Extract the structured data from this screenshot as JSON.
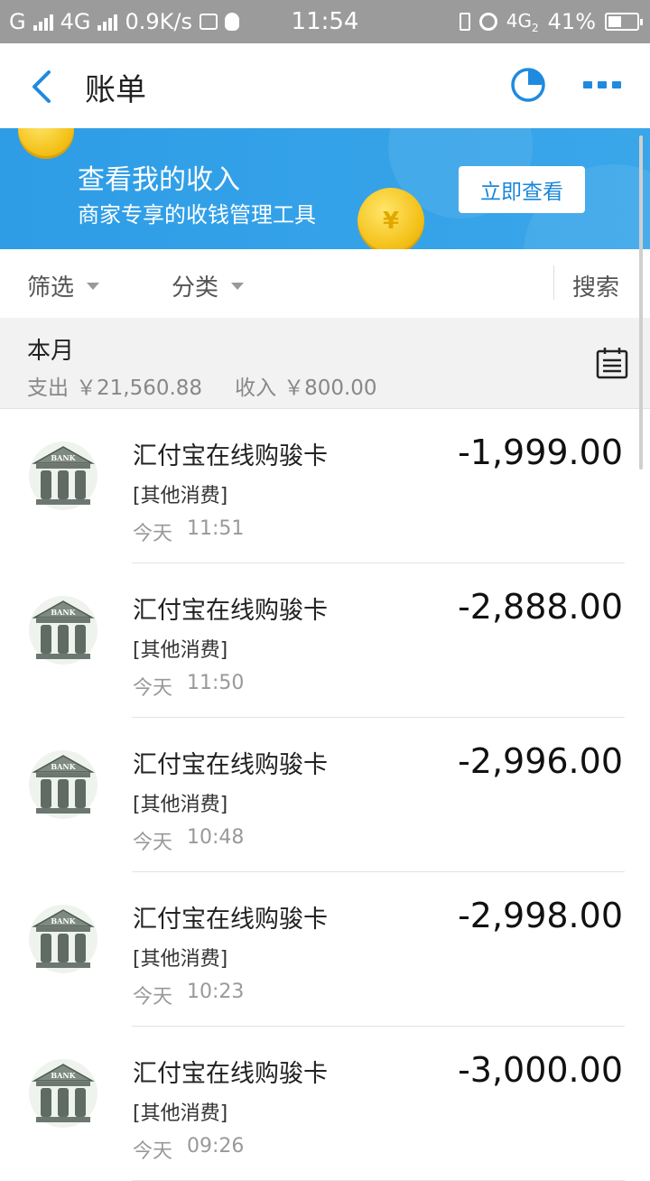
{
  "status_bar": {
    "carrier_left": "G",
    "net_type": "4G",
    "speed": "0.9K/s",
    "time": "11:54",
    "net_type_right": "4G",
    "net_sub": "2",
    "battery": "41%"
  },
  "header": {
    "title": "账单",
    "accent_color": "#1f8ae0"
  },
  "banner": {
    "title": "查看我的收入",
    "subtitle": "商家专享的收钱管理工具",
    "button_label": "立即查看",
    "coin_symbol": "¥"
  },
  "filter_bar": {
    "filter_label": "筛选",
    "category_label": "分类",
    "search_label": "搜索"
  },
  "month_section": {
    "title": "本月",
    "expense_label": "支出",
    "expense_value": "￥21,560.88",
    "income_label": "收入",
    "income_value": "￥800.00"
  },
  "transactions": [
    {
      "name": "汇付宝在线购骏卡",
      "category": "[其他消费]",
      "day": "今天",
      "time": "11:51",
      "amount": "-1,999.00",
      "icon": "bank-icon",
      "icon_text": "BANK"
    },
    {
      "name": "汇付宝在线购骏卡",
      "category": "[其他消费]",
      "day": "今天",
      "time": "11:50",
      "amount": "-2,888.00",
      "icon": "bank-icon",
      "icon_text": "BANK"
    },
    {
      "name": "汇付宝在线购骏卡",
      "category": "[其他消费]",
      "day": "今天",
      "time": "10:48",
      "amount": "-2,996.00",
      "icon": "bank-icon",
      "icon_text": "BANK"
    },
    {
      "name": "汇付宝在线购骏卡",
      "category": "[其他消费]",
      "day": "今天",
      "time": "10:23",
      "amount": "-2,998.00",
      "icon": "bank-icon",
      "icon_text": "BANK"
    },
    {
      "name": "汇付宝在线购骏卡",
      "category": "[其他消费]",
      "day": "今天",
      "time": "09:26",
      "amount": "-3,000.00",
      "icon": "bank-icon",
      "icon_text": "BANK"
    }
  ]
}
